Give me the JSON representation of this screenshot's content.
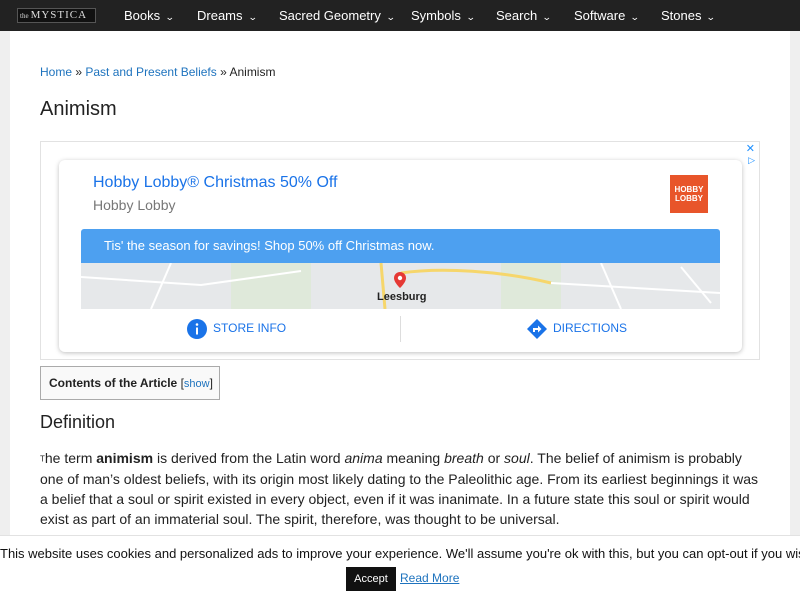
{
  "nav": {
    "logo_small": "the",
    "logo_big": "MYSTICA",
    "items": [
      {
        "label": "Books"
      },
      {
        "label": "Dreams"
      },
      {
        "label": "Sacred Geometry"
      },
      {
        "label": "Symbols"
      },
      {
        "label": "Search"
      },
      {
        "label": "Software"
      },
      {
        "label": "Stones"
      }
    ]
  },
  "breadcrumb": {
    "home": "Home",
    "sep1": " » ",
    "parent": "Past and Present Beliefs",
    "sep2": " » ",
    "current": "Animism"
  },
  "page": {
    "title": "Animism"
  },
  "ad": {
    "close_glyph": "✕",
    "choices_glyph": "▷",
    "headline": "Hobby Lobby® Christmas 50% Off",
    "advertiser": "Hobby Lobby",
    "logo_line1": "HOBBY",
    "logo_line2": "LOBBY",
    "banner": "Tis' the season for savings! Shop 50% off Christmas now.",
    "map_label": "Leesburg",
    "store_info": "STORE INFO",
    "directions": "DIRECTIONS",
    "colors": {
      "link": "#1a73e8",
      "banner": "#4da0f0",
      "logo": "#e8552a"
    }
  },
  "toc": {
    "title": "Contents of the Article",
    "open_bracket": " [",
    "show": "show",
    "close_bracket": "]"
  },
  "section": {
    "heading": "Definition"
  },
  "paragraph": {
    "dropcap": "T",
    "p1": "he term ",
    "b1": "animism",
    "p2": " is derived from the Latin word ",
    "i1": "anima",
    "p3": " meaning ",
    "i2": "breath",
    "p4": " or ",
    "i3": "soul",
    "p5": ". The belief of animism is probably one of man’s oldest beliefs, with its origin most likely dating to the Paleolithic age. From its earliest beginnings it was a belief that a soul or spirit existed in every object, even if it was inanimate. In a future state this soul or spirit would exist as part of an immaterial soul. The spirit, therefore, was thought to be universal."
  },
  "cookie": {
    "text": "This website uses cookies and personalized ads to improve your experience. We'll assume you're ok with this, but you can opt-out if you wish.",
    "accept": "Accept",
    "read_more": "Read More"
  }
}
